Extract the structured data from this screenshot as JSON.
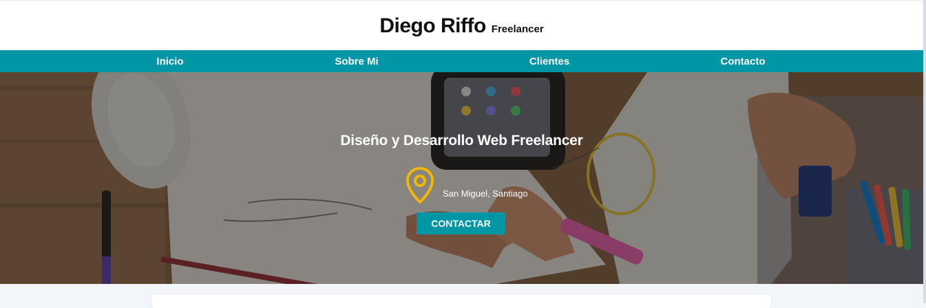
{
  "header": {
    "title": "Diego Riffo",
    "subtitle": "Freelancer"
  },
  "nav": {
    "items": [
      {
        "label": "Inicio"
      },
      {
        "label": "Sobre Mi"
      },
      {
        "label": "Clientes"
      },
      {
        "label": "Contacto"
      }
    ]
  },
  "hero": {
    "title": "Diseño y Desarrollo Web Freelancer",
    "location": "San Miguel, Santiago",
    "location_icon": "location-pin-icon",
    "button_label": "CONTACTAR"
  },
  "colors": {
    "accent": "#0096a5",
    "icon": "#f2b705",
    "header_bg": "#ffffff",
    "page_bg": "#f3f6f9",
    "text_dark": "#111111"
  }
}
